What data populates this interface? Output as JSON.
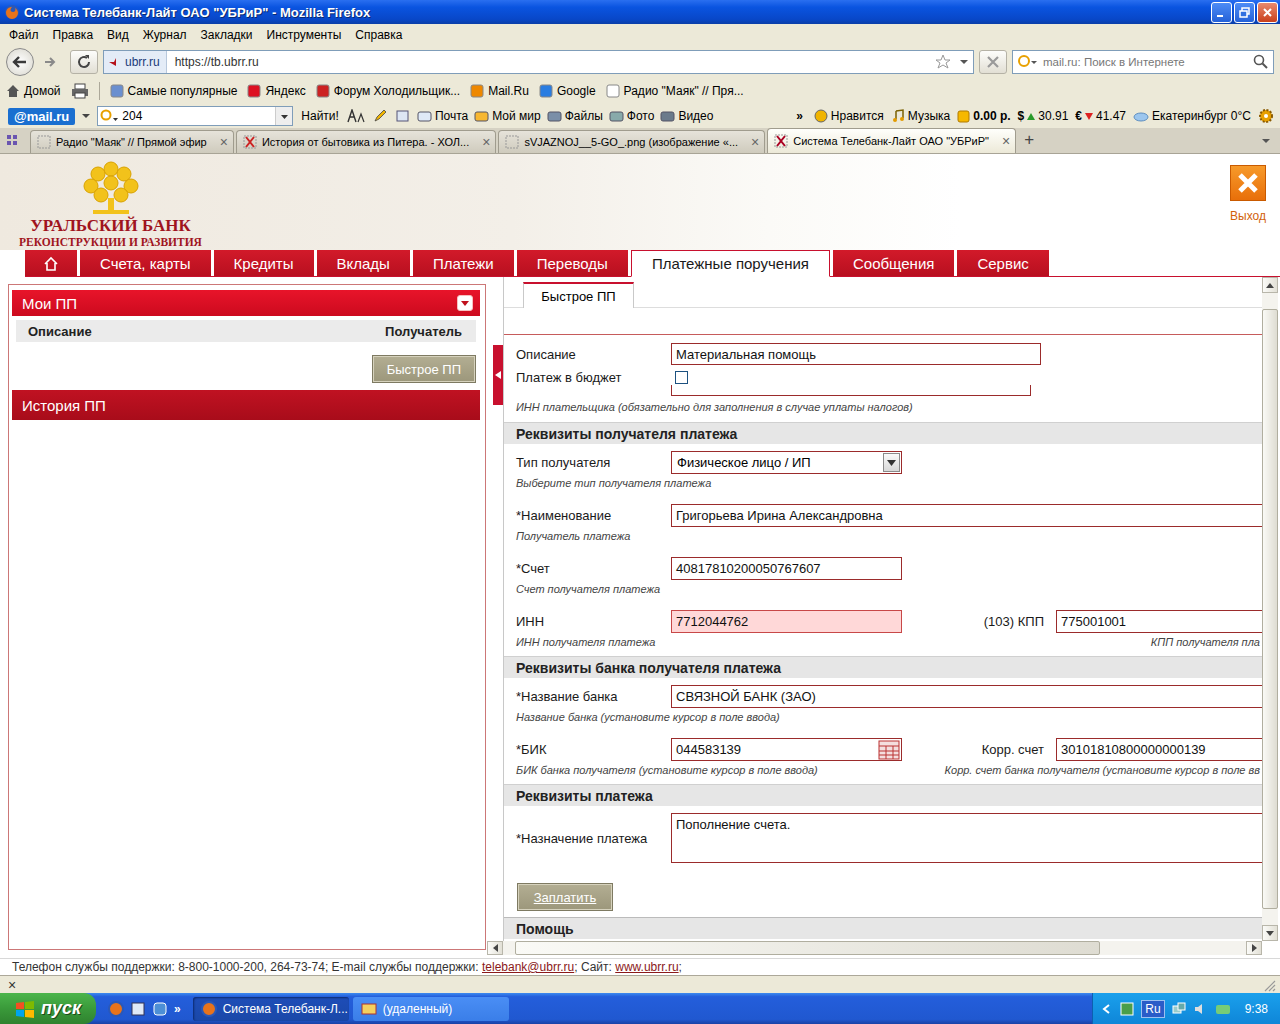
{
  "window": {
    "title": "Система Телебанк-Лайт ОАО \"УБРиР\" - Mozilla Firefox"
  },
  "menu": [
    "Файл",
    "Правка",
    "Вид",
    "Журнал",
    "Закладки",
    "Инструменты",
    "Справка"
  ],
  "navbar": {
    "site": "ubrr.ru",
    "address": "https://tb.ubrr.ru",
    "search_placeholder": "mail.ru: Поиск в Интернете"
  },
  "bookmarks": {
    "home": "Домой",
    "items": [
      "Самые популярные",
      "Яндекс",
      "Форум Холодильщик...",
      "Mail.Ru",
      "Google",
      "Радио \"Маяк\" // Пря..."
    ]
  },
  "mailru": {
    "logo": "@mail.ru",
    "query": "204",
    "find": "Найти!",
    "links": [
      "Почта",
      "Мой мир",
      "Файлы",
      "Фото",
      "Видео"
    ],
    "more": "»",
    "like": "Нравится",
    "music": "Музыка",
    "balance": "0.00 р.",
    "usd_sign": "$",
    "usd": "30.91",
    "eur_sign": "€",
    "eur": "41.47",
    "weather": "Екатеринбург 0°C"
  },
  "tabs": [
    {
      "label": "Радио \"Маяк\" // Прямой эфир",
      "selected": false
    },
    {
      "label": "История от бытовика из Питера. - ХОЛ...",
      "selected": false
    },
    {
      "label": "sVJAZNOJ__5-GO_.png (изображение «...",
      "selected": false
    },
    {
      "label": "Система Телебанк-Лайт ОАО \"УБРиР\"",
      "selected": true
    }
  ],
  "tab_close": "×",
  "new_tab": "+",
  "bank": {
    "logo_line1": "УРАЛЬСКИЙ БАНК",
    "logo_line2": "РЕКОНСТРУКЦИИ И РАЗВИТИЯ",
    "exit": "Выход",
    "nav": [
      {
        "label": "Счета, карты",
        "selected": false
      },
      {
        "label": "Кредиты",
        "selected": false
      },
      {
        "label": "Вклады",
        "selected": false
      },
      {
        "label": "Платежи",
        "selected": false
      },
      {
        "label": "Переводы",
        "selected": false
      },
      {
        "label": "Платежные поручения",
        "selected": true
      },
      {
        "label": "Сообщения",
        "selected": false
      },
      {
        "label": "Сервис",
        "selected": false
      }
    ]
  },
  "left": {
    "my_title": "Мои ПП",
    "columns": [
      "Описание",
      "Получатель"
    ],
    "quick_button": "Быстрое ПП",
    "history_title": "История ПП"
  },
  "form": {
    "tab": "Быстрое ПП",
    "description": {
      "label": "Описание",
      "value": "Материальная помощь"
    },
    "budget": {
      "label": "Платеж в бюджет",
      "checked": false
    },
    "payer_inn_hint": "ИНН плательщика (обязательно для заполнения в случае уплаты налогов)",
    "sections": [
      {
        "title": "Реквизиты получателя платежа",
        "rows": [
          {
            "kind": "select",
            "label": "Тип получателя",
            "value": "Физическое лицо / ИП",
            "hint": "Выберите тип получателя платежа"
          },
          {
            "kind": "wide",
            "label": "*Наименование",
            "value": "Григорьева Ирина Александровна",
            "hint": "Получатель платежа"
          },
          {
            "kind": "short",
            "label": "*Счет",
            "value": "40817810200050767607",
            "hint": "Счет получателя платежа"
          },
          {
            "kind": "pair",
            "label": "ИНН",
            "value": "7712044762",
            "invalid": true,
            "picker": false,
            "hint": "ИНН получателя платежа",
            "label2": "(103) КПП",
            "value2": "775001001",
            "hint2": "КПП получателя пла"
          }
        ]
      },
      {
        "title": "Реквизиты банка получателя платежа",
        "rows": [
          {
            "kind": "wide",
            "label": "*Название банка",
            "value": "СВЯЗНОЙ БАНК (ЗАО)",
            "hint": "Название банка (установите курсор в поле ввода)"
          },
          {
            "kind": "pair",
            "label": "*БИК",
            "value": "044583139",
            "invalid": false,
            "picker": true,
            "hint": "БИК банка получателя (установите курсор в поле ввода)",
            "label2": "Корр. счет",
            "value2": "30101810800000000139",
            "hint2": "Корр. счет банка получателя (установите курсор в поле вв"
          }
        ]
      },
      {
        "title": "Реквизиты платежа",
        "rows": [
          {
            "kind": "textarea",
            "label": "*Назначение платежа",
            "value": "Пополнение счета."
          }
        ]
      }
    ],
    "pay_button": "Заплатить",
    "help_title": "Помощь"
  },
  "scroll": {
    "vertical": 0.95,
    "horizontal": 0.8
  },
  "page_status": {
    "text1": "Телефон службы поддержки: 8-800-1000-200, 264-73-74; E-mail службы поддержки: ",
    "email": "telebank@ubrr.ru",
    "text2": "; Сайт: ",
    "site": "www.ubrr.ru",
    "text3": ";"
  },
  "ff_status": {
    "close": "×"
  },
  "taskbar": {
    "start": "пуск",
    "more": "»",
    "tasks": [
      {
        "label": "Система Телебанк-Л...",
        "selected": true
      },
      {
        "label": "(удаленный)",
        "selected": false
      }
    ],
    "lang": "Ru",
    "clock": "9:38"
  }
}
